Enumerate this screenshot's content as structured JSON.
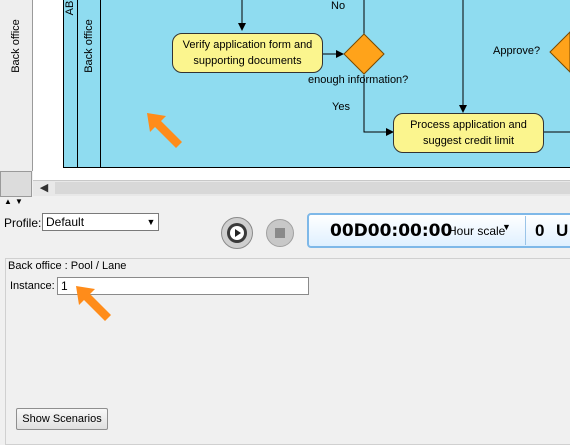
{
  "diagram": {
    "side_tab_label": "Back office",
    "pool_label": "AB",
    "lane_label": "Back office",
    "tasks": [
      {
        "id": "verify",
        "text": "Verify application form and supporting documents"
      },
      {
        "id": "process",
        "text": "Process application and suggest credit limit"
      }
    ],
    "labels": {
      "no": "No",
      "yes": "Yes",
      "enough_info": "enough information?",
      "approve": "Approve?"
    }
  },
  "simulation": {
    "profile_label": "Profile:",
    "profile_value": "Default",
    "clock_time": "00D00:00:00",
    "time_scale": "Hour scale",
    "counter": "0",
    "counter_unit_partial": "U"
  },
  "properties": {
    "title": "Back office : Pool / Lane",
    "instance_label": "Instance:",
    "instance_value": "1",
    "show_scenarios_label": "Show Scenarios"
  },
  "colors": {
    "lane_fill": "#8fdcf0",
    "task_fill": "#fbf58e",
    "gateway_fill": "#ffa31a",
    "annotation_arrow": "#ff8c1a"
  },
  "icons": {
    "play": "play-gear-icon",
    "stop": "stop-icon"
  }
}
